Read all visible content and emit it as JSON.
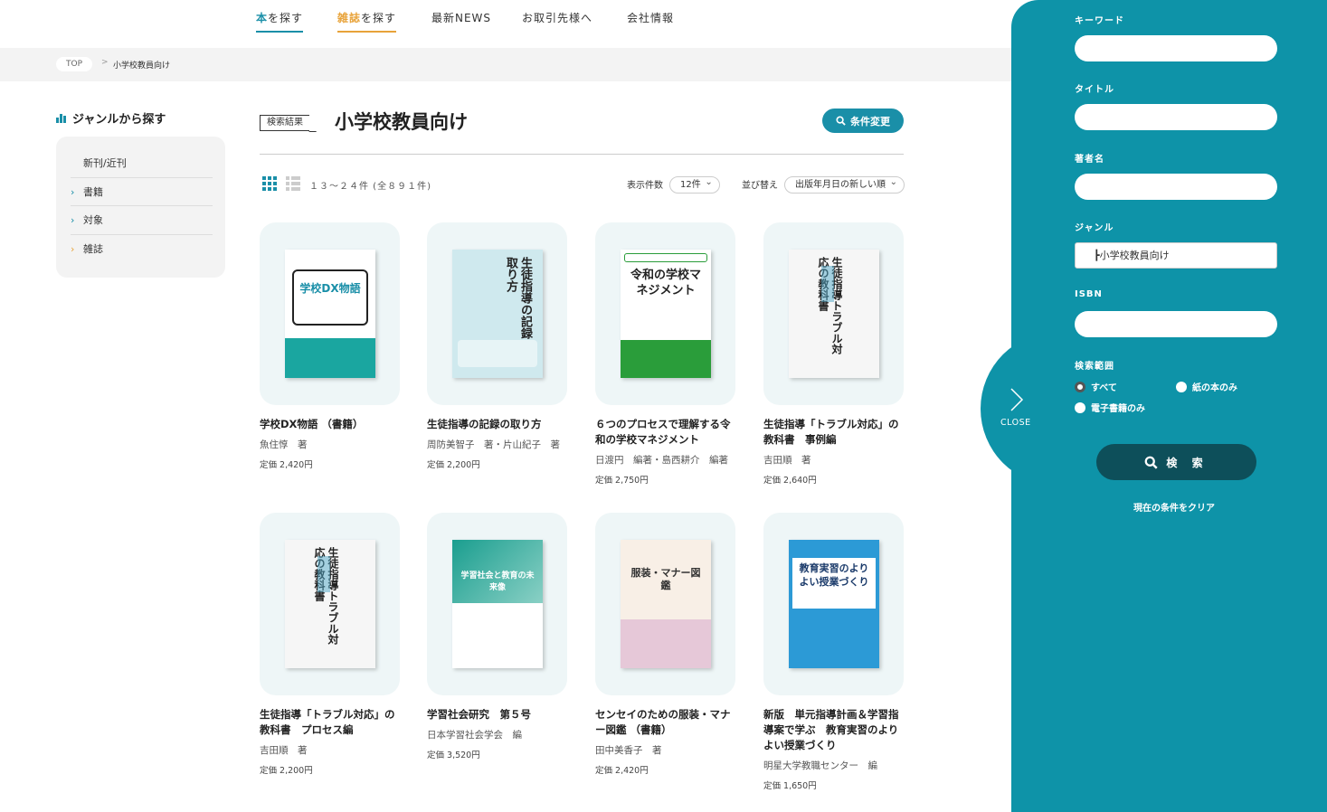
{
  "nav": {
    "items": [
      {
        "hl": "本",
        "rest": "を探す"
      },
      {
        "hl": "雑誌",
        "rest": "を探す"
      },
      {
        "hl": "",
        "rest": "最新NEWS"
      },
      {
        "hl": "",
        "rest": "お取引先様へ"
      },
      {
        "hl": "",
        "rest": "会社情報"
      }
    ],
    "accent_book": "#1a8fa8",
    "accent_magazine": "#e8a33a"
  },
  "breadcrumb": {
    "top": "TOP",
    "sep": ">",
    "current": "小学校教員向け"
  },
  "genre": {
    "heading": "ジャンルから探す",
    "items": [
      {
        "label": "新刊/近刊",
        "chevron": ""
      },
      {
        "label": "書籍",
        "chevron": "›"
      },
      {
        "label": "対象",
        "chevron": "›"
      },
      {
        "label": "雑誌",
        "chevron": "›"
      }
    ]
  },
  "results": {
    "tag": "検索結果",
    "title": "小学校教員向け",
    "condition_button": "条件変更",
    "count": "１３～２４件 (全８９１件)",
    "per_page_label": "表示件数",
    "per_page_value": "12件",
    "sort_label": "並び替え",
    "sort_value": "出版年月日の新しい順"
  },
  "books": [
    {
      "title": "学校DX物語 （書籍）",
      "author": "魚住惇　著",
      "price": "定価 2,420円",
      "cover_title": "学校DX物語"
    },
    {
      "title": "生徒指導の記録の取り方",
      "author": "周防美智子　著・片山紀子　著",
      "price": "定価 2,200円",
      "cover_title": "生徒指導の記録の取り方"
    },
    {
      "title": "６つのプロセスで理解する令和の学校マネジメント",
      "author": "日渡円　編著・島西耕介　編著",
      "price": "定価 2,750円",
      "cover_title": "令和の学校マネジメント"
    },
    {
      "title": "生徒指導「トラブル対応」の教科書　事例編",
      "author": "吉田順　著",
      "price": "定価 2,640円",
      "cover_title": "生徒指導トラブル対応の教科書"
    },
    {
      "title": "生徒指導「トラブル対応」の教科書　プロセス編",
      "author": "吉田順　著",
      "price": "定価 2,200円",
      "cover_title": "生徒指導トラブル対応の教科書"
    },
    {
      "title": "学習社会研究　第５号",
      "author": "日本学習社会学会　編",
      "price": "定価 3,520円",
      "cover_title": "学習社会と教育の未来像"
    },
    {
      "title": "センセイのための服装・マナー図鑑 （書籍）",
      "author": "田中美香子　著",
      "price": "定価 2,420円",
      "cover_title": "服装・マナー図鑑"
    },
    {
      "title": "新版　単元指導計画＆学習指導案で学ぶ　教育実習のよりよい授業づくり",
      "author": "明星大学教職センター　編",
      "price": "定価 1,650円",
      "cover_title": "教育実習のよりよい授業づくり"
    }
  ],
  "panel": {
    "bg": "#0e93a8",
    "close_label": "CLOSE",
    "fields": [
      {
        "label": "キーワード",
        "value": ""
      },
      {
        "label": "タイトル",
        "value": ""
      },
      {
        "label": "著者名",
        "value": ""
      },
      {
        "label": "ジャンル",
        "value": "┣小学校教員向け"
      },
      {
        "label": "ISBN",
        "value": ""
      }
    ],
    "scope_label": "検索範囲",
    "scope_options": [
      "すべて",
      "紙の本のみ",
      "電子書籍のみ"
    ],
    "scope_selected": "すべて",
    "search_button": "検 索",
    "clear_link": "現在の条件をクリア"
  }
}
